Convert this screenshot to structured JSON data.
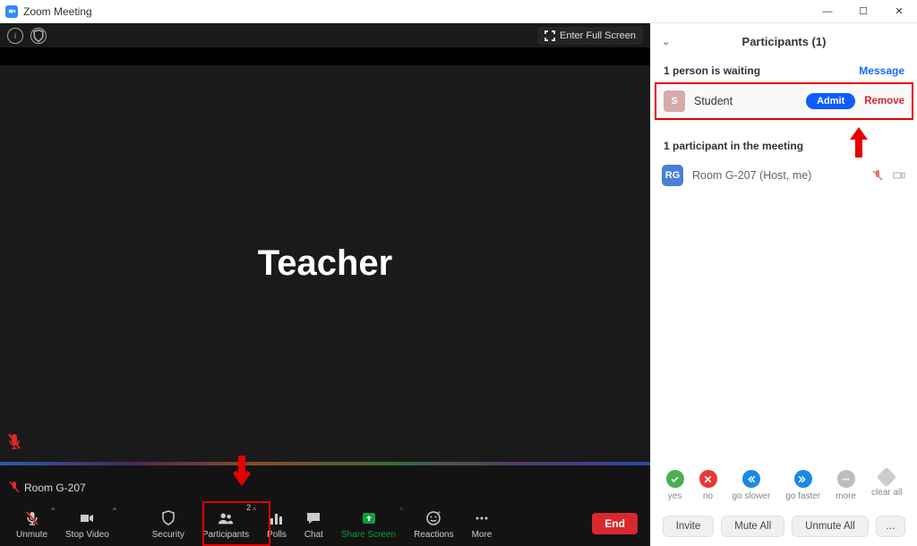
{
  "titlebar": {
    "title": "Zoom Meeting"
  },
  "video": {
    "enter_fullscreen": "Enter Full Screen",
    "main_label": "Teacher",
    "name_chip": "Room G-207"
  },
  "toolbar": {
    "unmute": "Unmute",
    "stop_video": "Stop Video",
    "security": "Security",
    "participants": "Participants",
    "participants_count": "2",
    "polls": "Polls",
    "chat": "Chat",
    "share_screen": "Share Screen",
    "reactions": "Reactions",
    "more": "More",
    "end": "End"
  },
  "panel": {
    "header": "Participants (1)",
    "waiting_label": "1 person is waiting",
    "message": "Message",
    "waiting": {
      "initial": "S",
      "name": "Student",
      "admit": "Admit",
      "remove": "Remove"
    },
    "in_meeting_label": "1 participant in the meeting",
    "host": {
      "initial": "RG",
      "name": "Room G-207 (Host, me)"
    },
    "reactions": {
      "yes": "yes",
      "no": "no",
      "go_slower": "go slower",
      "go_faster": "go faster",
      "more": "more",
      "clear_all": "clear all"
    },
    "footer": {
      "invite": "Invite",
      "mute_all": "Mute All",
      "unmute_all": "Unmute All"
    }
  }
}
